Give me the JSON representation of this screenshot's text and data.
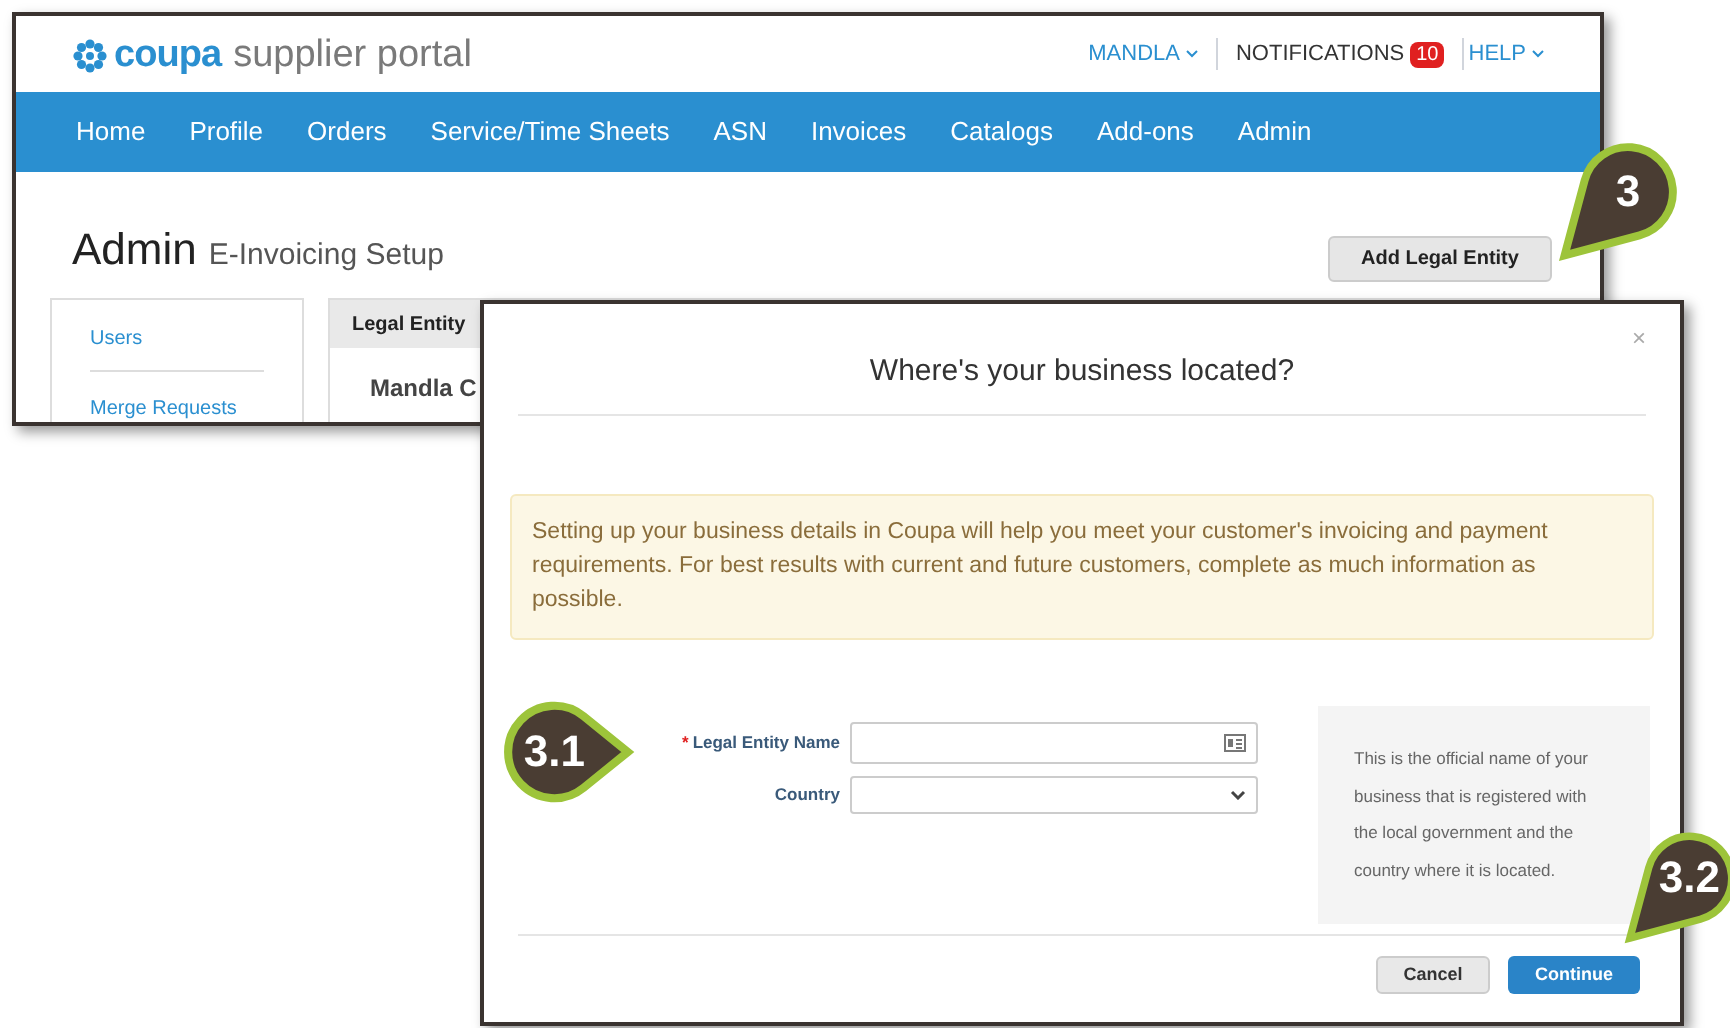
{
  "header": {
    "logo_brand": "coupa",
    "logo_product": "supplier portal",
    "user_menu": "MANDLA",
    "notifications": {
      "label": "NOTIFICATIONS",
      "count": "10"
    },
    "help": "HELP"
  },
  "nav": [
    {
      "label": "Home"
    },
    {
      "label": "Profile"
    },
    {
      "label": "Orders"
    },
    {
      "label": "Service/Time Sheets"
    },
    {
      "label": "ASN"
    },
    {
      "label": "Invoices"
    },
    {
      "label": "Catalogs"
    },
    {
      "label": "Add-ons"
    },
    {
      "label": "Admin"
    }
  ],
  "page": {
    "title": "Admin",
    "subtitle": "E-Invoicing Setup",
    "add_button": "Add Legal Entity"
  },
  "sidebar": [
    {
      "label": "Users"
    },
    {
      "label": "Merge Requests"
    }
  ],
  "table": {
    "column_1": "Legal Entity",
    "row_1": "Mandla C"
  },
  "dialog": {
    "close": "×",
    "title": "Where's your business located?",
    "notice": "Setting up your business details in Coupa will help you meet your customer's invoicing and payment requirements. For best results with current and future customers, complete as much information as possible.",
    "fields": [
      {
        "kind": "text",
        "marker": "*",
        "label": "Legal Entity Name"
      },
      {
        "kind": "select",
        "label": "Country"
      }
    ],
    "help_text": "This is the official name of your business that is registered with the local government and the country where it is located.",
    "buttons": [
      {
        "kind": "secondary",
        "label": "Cancel"
      },
      {
        "kind": "primary",
        "label": "Continue"
      }
    ]
  },
  "callouts": [
    {
      "label": "3"
    },
    {
      "label": "3.1"
    },
    {
      "label": "3.2"
    }
  ]
}
